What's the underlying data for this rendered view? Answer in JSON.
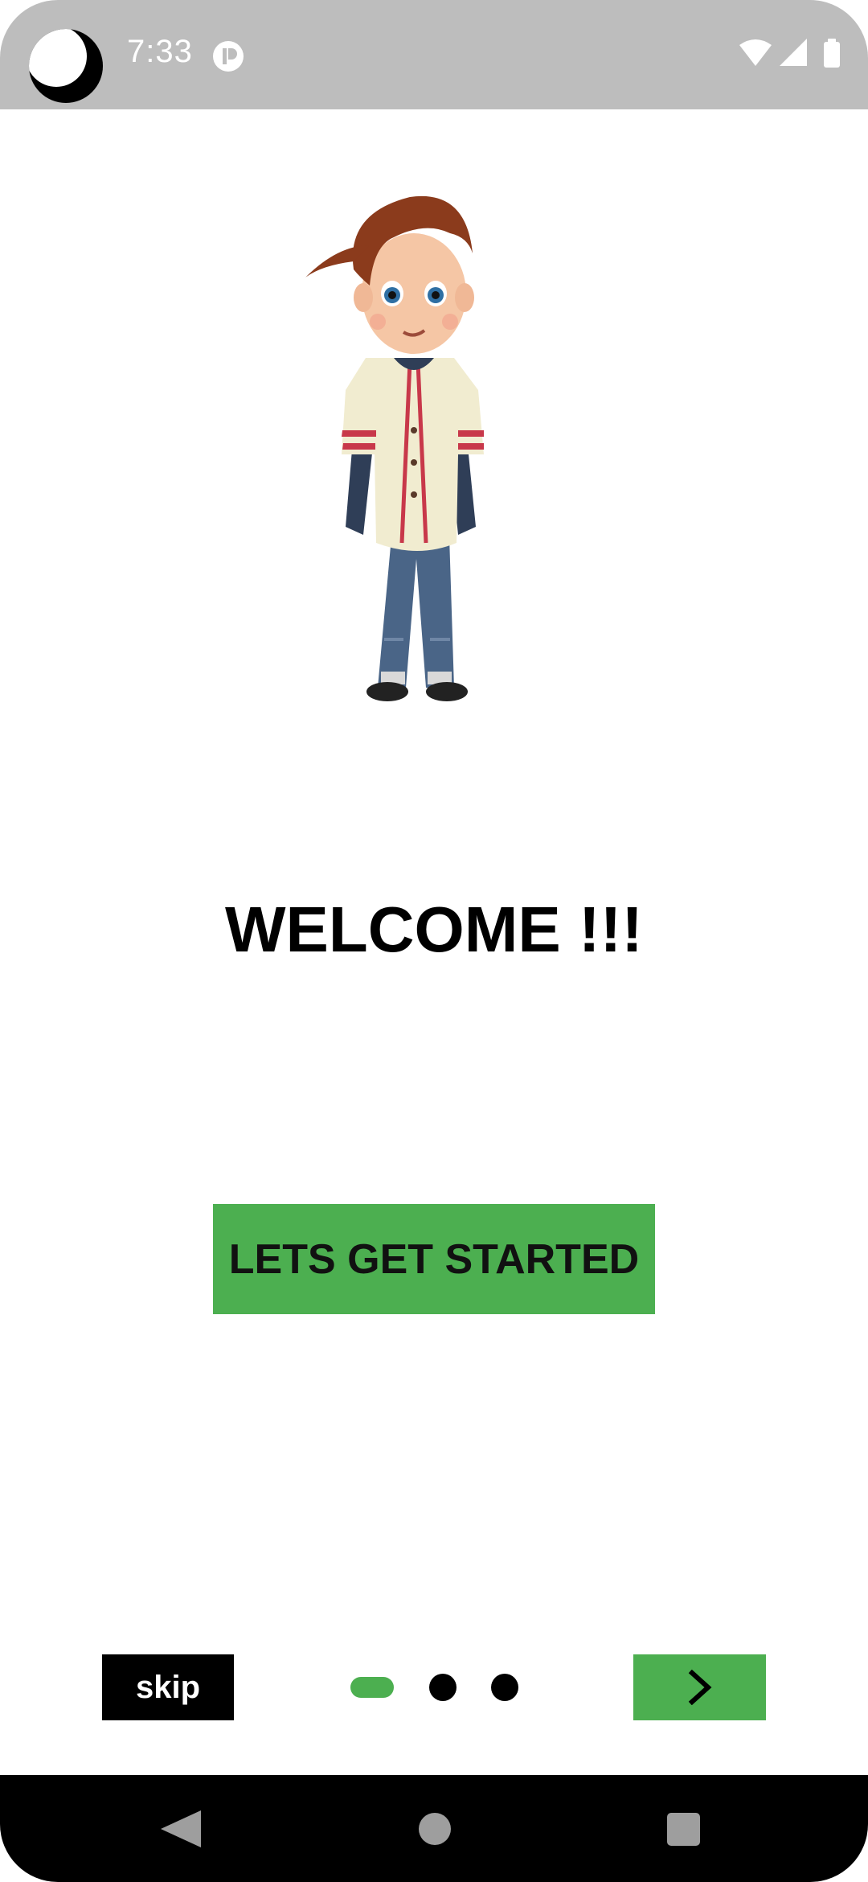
{
  "status_bar": {
    "time": "7:33",
    "icons": [
      "moon-icon",
      "notification-app-icon",
      "wifi-icon",
      "cellular-signal-icon",
      "battery-icon"
    ]
  },
  "illustration": {
    "name": "boy-character-illustration"
  },
  "main": {
    "title": "WELCOME !!!",
    "cta_label": "LETS GET STARTED"
  },
  "bottom_bar": {
    "skip_label": "skip",
    "page_count": 3,
    "current_page": 1,
    "next_icon": "chevron-right-icon"
  },
  "nav_bar": {
    "icons": [
      "back-icon",
      "home-icon",
      "recents-icon"
    ]
  },
  "colors": {
    "accent": "#4caf50",
    "status_bar": "#bdbdbd",
    "text": "#000000",
    "background": "#ffffff"
  }
}
